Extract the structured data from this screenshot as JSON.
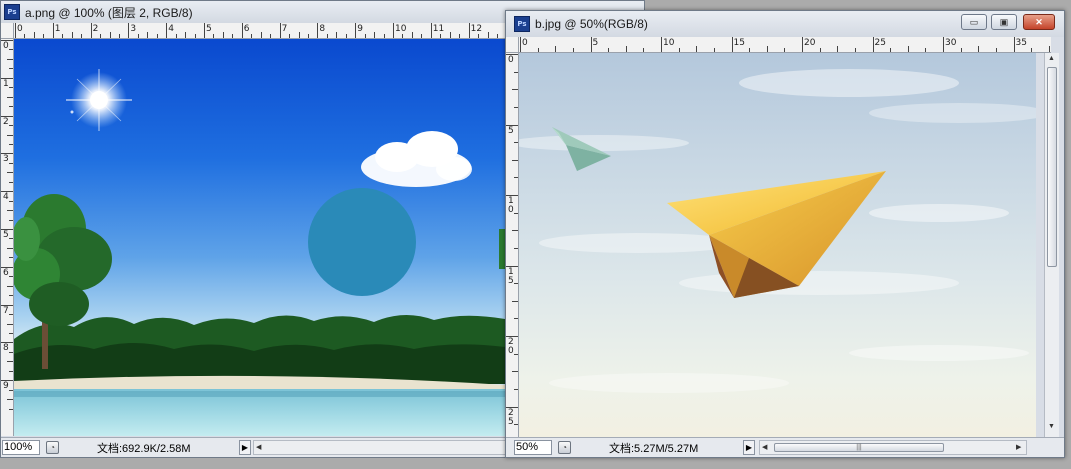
{
  "window_a": {
    "title": "a.png @ 100% (图层 2, RGB/8)",
    "icon": "Ps",
    "ruler_h": [
      "0",
      "1",
      "2",
      "3",
      "4",
      "5",
      "6",
      "7",
      "8",
      "9",
      "10",
      "11",
      "12"
    ],
    "ruler_v": [
      "0",
      "1",
      "2",
      "3",
      "4",
      "5",
      "6",
      "7",
      "8",
      "9"
    ],
    "status": {
      "zoom": "100%",
      "doc_info": "文档:692.9K/2.58M"
    }
  },
  "window_b": {
    "title": "b.jpg @ 50%(RGB/8)",
    "icon": "Ps",
    "ruler_h": [
      "0",
      "5",
      "10",
      "15",
      "20",
      "25",
      "30",
      "35"
    ],
    "ruler_v": [
      "0",
      "5",
      "10",
      "15",
      "20",
      "25"
    ],
    "status": {
      "zoom": "50%",
      "doc_info": "文档:5.27M/5.27M"
    },
    "controls": {
      "minimize": "▭",
      "restore": "▣",
      "close": "✕"
    }
  },
  "colors": {
    "sky_top": "#0a49cf",
    "circle": "#2a8ab8",
    "plane_yellow": "#f5c63a",
    "plane_small": "#8fbfb0"
  }
}
